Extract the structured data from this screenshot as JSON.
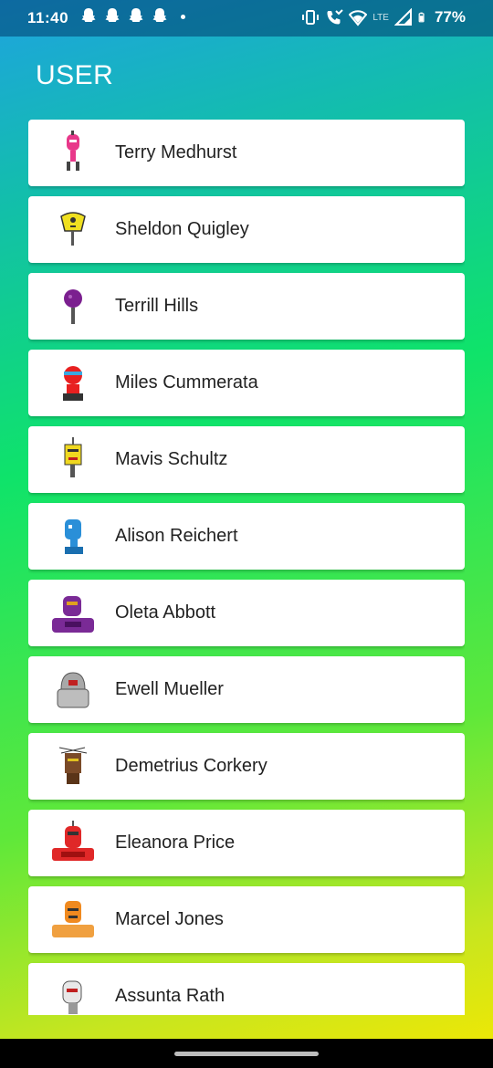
{
  "status": {
    "time": "11:40",
    "battery": "77%",
    "network": "LTE"
  },
  "app": {
    "title": "USER"
  },
  "users": [
    {
      "name": "Terry Medhurst",
      "color": "#e8388a",
      "avatar": "pink-robot-avatar"
    },
    {
      "name": "Sheldon Quigley",
      "color": "#f0e020",
      "avatar": "yellow-robot-avatar"
    },
    {
      "name": "Terrill Hills",
      "color": "#7b1f8f",
      "avatar": "purple-robot-avatar"
    },
    {
      "name": "Miles Cummerata",
      "color": "#e82020",
      "avatar": "red-robot-avatar"
    },
    {
      "name": "Mavis Schultz",
      "color": "#f0d820",
      "avatar": "yellow-robot-avatar"
    },
    {
      "name": "Alison Reichert",
      "color": "#2a8fd8",
      "avatar": "blue-robot-avatar"
    },
    {
      "name": "Oleta Abbott",
      "color": "#7a2a96",
      "avatar": "purple-robot-avatar"
    },
    {
      "name": "Ewell Mueller",
      "color": "#a8a8a8",
      "avatar": "gray-robot-avatar"
    },
    {
      "name": "Demetrius Corkery",
      "color": "#7a4a28",
      "avatar": "brown-robot-avatar"
    },
    {
      "name": "Eleanora Price",
      "color": "#e02828",
      "avatar": "red-robot-avatar"
    },
    {
      "name": "Marcel Jones",
      "color": "#f08a20",
      "avatar": "orange-robot-avatar"
    },
    {
      "name": "Assunta Rath",
      "color": "#d8d8d8",
      "avatar": "white-robot-avatar"
    }
  ]
}
